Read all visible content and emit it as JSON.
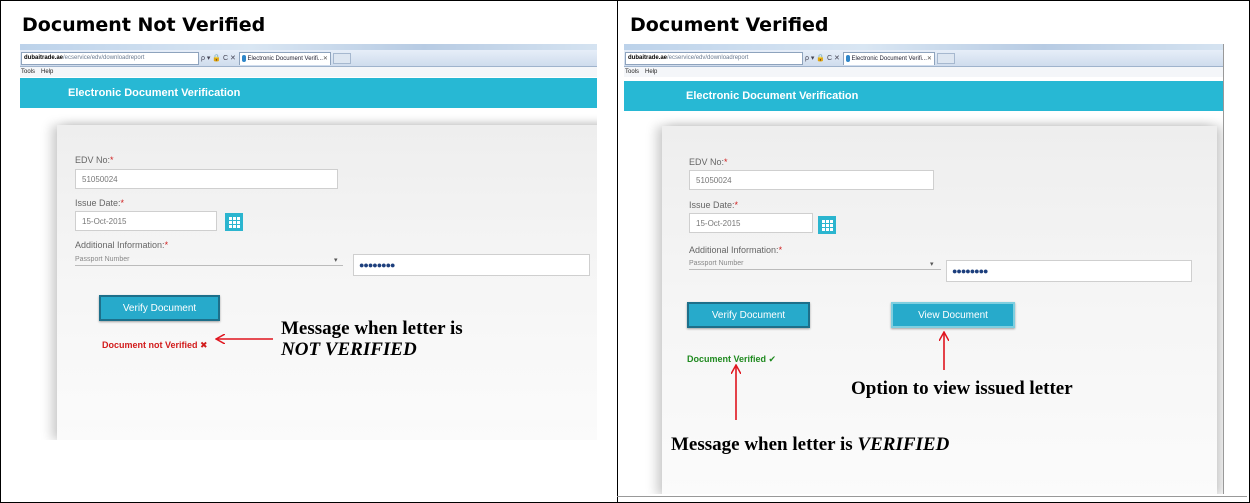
{
  "headings": {
    "left": "Document Not Verified",
    "right": "Document Verified"
  },
  "browser": {
    "address_domain": "dubaitrade.ae",
    "address_rest": "/ecservice/edv/downloadreport",
    "address_icons": "ρ ▾ 🔒 C ✕",
    "tab_title": "Electronic Document Verifi...",
    "tab_close": "✕",
    "menu_tools": "Tools",
    "menu_help": "Help"
  },
  "app": {
    "title": "Electronic Document Verification"
  },
  "form": {
    "edv_label": "EDV No:",
    "edv_value": "51050024",
    "issue_label": "Issue Date:",
    "issue_value": "15-Oct-2015",
    "additional_label": "Additional Information:",
    "required_mark": "*",
    "select_value": "Passport Number",
    "select_caret": "▾",
    "passport_masked": "●●●●●●●●",
    "verify_button": "Verify Document",
    "view_button": "View Document"
  },
  "status": {
    "not_verified": "Document not Verified ✖",
    "verified": "Document Verified ✔"
  },
  "annotations": {
    "not_verified_line1": "Message when letter is",
    "not_verified_line2": "NOT VERIFIED",
    "view_option": "Option to view issued letter",
    "verified_prefix": "Message when letter is ",
    "verified_word": "VERIFIED"
  },
  "colors": {
    "header_bg": "#27b8d4",
    "button_bg": "#27aacb",
    "error_red": "#d21c1c",
    "success_green": "#1f8a1f",
    "arrow_red": "#e0141e"
  }
}
